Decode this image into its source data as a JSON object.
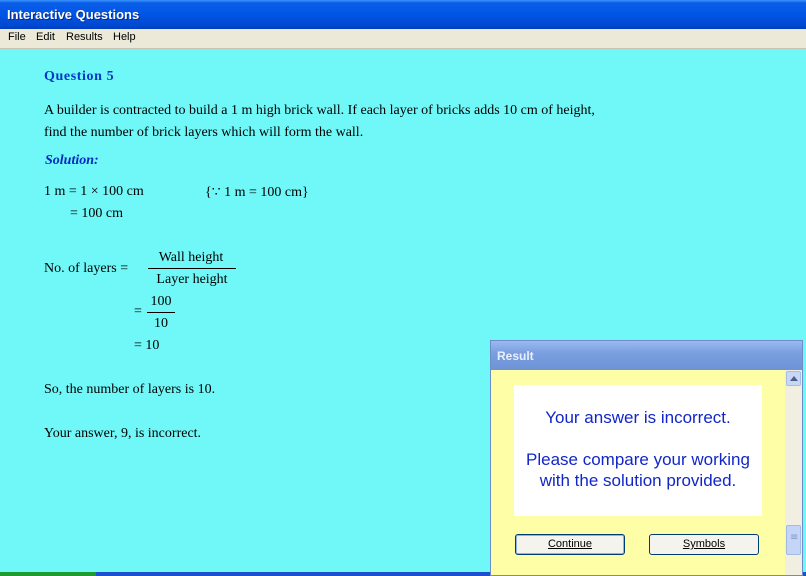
{
  "window": {
    "title": "Interactive Questions"
  },
  "menu": [
    "File",
    "Edit",
    "Results",
    "Help"
  ],
  "question": {
    "title": "Question 5",
    "line1": "A builder is contracted to build a 1 m high brick wall.  If each layer of bricks adds 10 cm of height,",
    "line2": "find the number of brick layers which will form the wall."
  },
  "solution": {
    "title": "Solution:",
    "conv_line1": "1 m = 1 × 100 cm",
    "conv_note": "{∵ 1 m = 100 cm}",
    "conv_line2": "= 100 cm",
    "layers_label": "No. of layers =",
    "frac1_num": "Wall height",
    "frac1_den": "Layer height",
    "eq": "=",
    "frac2_num": "100",
    "frac2_den": "10",
    "result_line": "= 10",
    "conclusion": "So, the number of layers is 10.",
    "your_answer": "Your answer, 9, is incorrect."
  },
  "dialog": {
    "title": "Result",
    "message1": "Your answer is incorrect.",
    "message2": "Please compare your working with the solution provided.",
    "continue_label": "Continue",
    "symbols_label": "Symbols"
  }
}
